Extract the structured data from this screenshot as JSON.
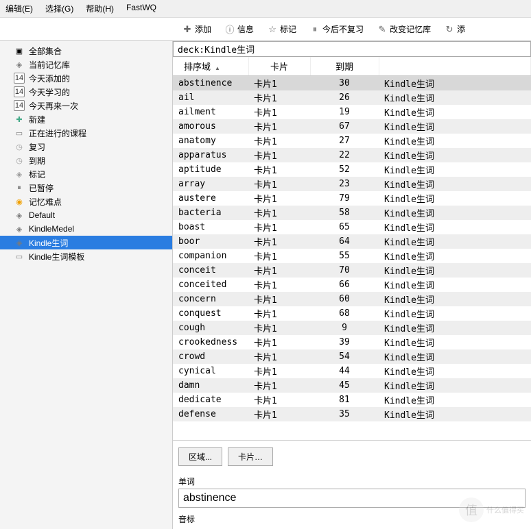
{
  "menu": {
    "edit": "编辑(E)",
    "select": "选择(G)",
    "help": "帮助(H)",
    "fastwq": "FastWQ"
  },
  "toolbar": {
    "add": "添加",
    "info": "信息",
    "mark": "标记",
    "suspend": "今后不复习",
    "change_deck": "改变记忆库",
    "add2": "添"
  },
  "sidebar": {
    "items": [
      {
        "icon": "collection",
        "label": "全部集合"
      },
      {
        "icon": "deck",
        "label": "当前记忆库"
      },
      {
        "icon": "cal",
        "label": "今天添加的"
      },
      {
        "icon": "cal",
        "label": "今天学习的"
      },
      {
        "icon": "cal",
        "label": "今天再来一次"
      },
      {
        "icon": "plus",
        "label": "新建"
      },
      {
        "icon": "book",
        "label": "正在进行的课程"
      },
      {
        "icon": "clock",
        "label": "复习"
      },
      {
        "icon": "clock",
        "label": "到期"
      },
      {
        "icon": "tag",
        "label": "标记"
      },
      {
        "icon": "pause",
        "label": "已暂停"
      },
      {
        "icon": "bulb",
        "label": "记忆难点"
      },
      {
        "icon": "deck",
        "label": "Default"
      },
      {
        "icon": "deck",
        "label": "KindleMedel"
      },
      {
        "icon": "deck",
        "label": "Kindle生词",
        "selected": true
      },
      {
        "icon": "book",
        "label": "Kindle生词模板"
      }
    ]
  },
  "search": {
    "value": "deck:Kindle生词"
  },
  "table": {
    "headers": {
      "sort_field": "排序域",
      "card": "卡片",
      "due": "到期",
      "deck": ""
    },
    "rows": [
      {
        "w": "abstinence",
        "c": "卡片1",
        "d": 30,
        "k": "Kindle生词"
      },
      {
        "w": "ail",
        "c": "卡片1",
        "d": 26,
        "k": "Kindle生词"
      },
      {
        "w": "ailment",
        "c": "卡片1",
        "d": 19,
        "k": "Kindle生词"
      },
      {
        "w": "amorous",
        "c": "卡片1",
        "d": 67,
        "k": "Kindle生词"
      },
      {
        "w": "anatomy",
        "c": "卡片1",
        "d": 27,
        "k": "Kindle生词"
      },
      {
        "w": "apparatus",
        "c": "卡片1",
        "d": 22,
        "k": "Kindle生词"
      },
      {
        "w": "aptitude",
        "c": "卡片1",
        "d": 52,
        "k": "Kindle生词"
      },
      {
        "w": "array",
        "c": "卡片1",
        "d": 23,
        "k": "Kindle生词"
      },
      {
        "w": "austere",
        "c": "卡片1",
        "d": 79,
        "k": "Kindle生词"
      },
      {
        "w": "bacteria",
        "c": "卡片1",
        "d": 58,
        "k": "Kindle生词"
      },
      {
        "w": "boast",
        "c": "卡片1",
        "d": 65,
        "k": "Kindle生词"
      },
      {
        "w": "boor",
        "c": "卡片1",
        "d": 64,
        "k": "Kindle生词"
      },
      {
        "w": "companion",
        "c": "卡片1",
        "d": 55,
        "k": "Kindle生词"
      },
      {
        "w": "conceit",
        "c": "卡片1",
        "d": 70,
        "k": "Kindle生词"
      },
      {
        "w": "conceited",
        "c": "卡片1",
        "d": 66,
        "k": "Kindle生词"
      },
      {
        "w": "concern",
        "c": "卡片1",
        "d": 60,
        "k": "Kindle生词"
      },
      {
        "w": "conquest",
        "c": "卡片1",
        "d": 68,
        "k": "Kindle生词"
      },
      {
        "w": "cough",
        "c": "卡片1",
        "d": 9,
        "k": "Kindle生词"
      },
      {
        "w": "crookedness",
        "c": "卡片1",
        "d": 39,
        "k": "Kindle生词"
      },
      {
        "w": "crowd",
        "c": "卡片1",
        "d": 54,
        "k": "Kindle生词"
      },
      {
        "w": "cynical",
        "c": "卡片1",
        "d": 44,
        "k": "Kindle生词"
      },
      {
        "w": "damn",
        "c": "卡片1",
        "d": 45,
        "k": "Kindle生词"
      },
      {
        "w": "dedicate",
        "c": "卡片1",
        "d": 81,
        "k": "Kindle生词"
      },
      {
        "w": "defense",
        "c": "卡片1",
        "d": 35,
        "k": "Kindle生词"
      }
    ]
  },
  "buttons": {
    "fields": "区域...",
    "cards": "卡片…"
  },
  "editor": {
    "field1_label": "单词",
    "field1_value": "abstinence",
    "field2_label": "音标"
  },
  "watermark": {
    "text": "什么值得买"
  }
}
